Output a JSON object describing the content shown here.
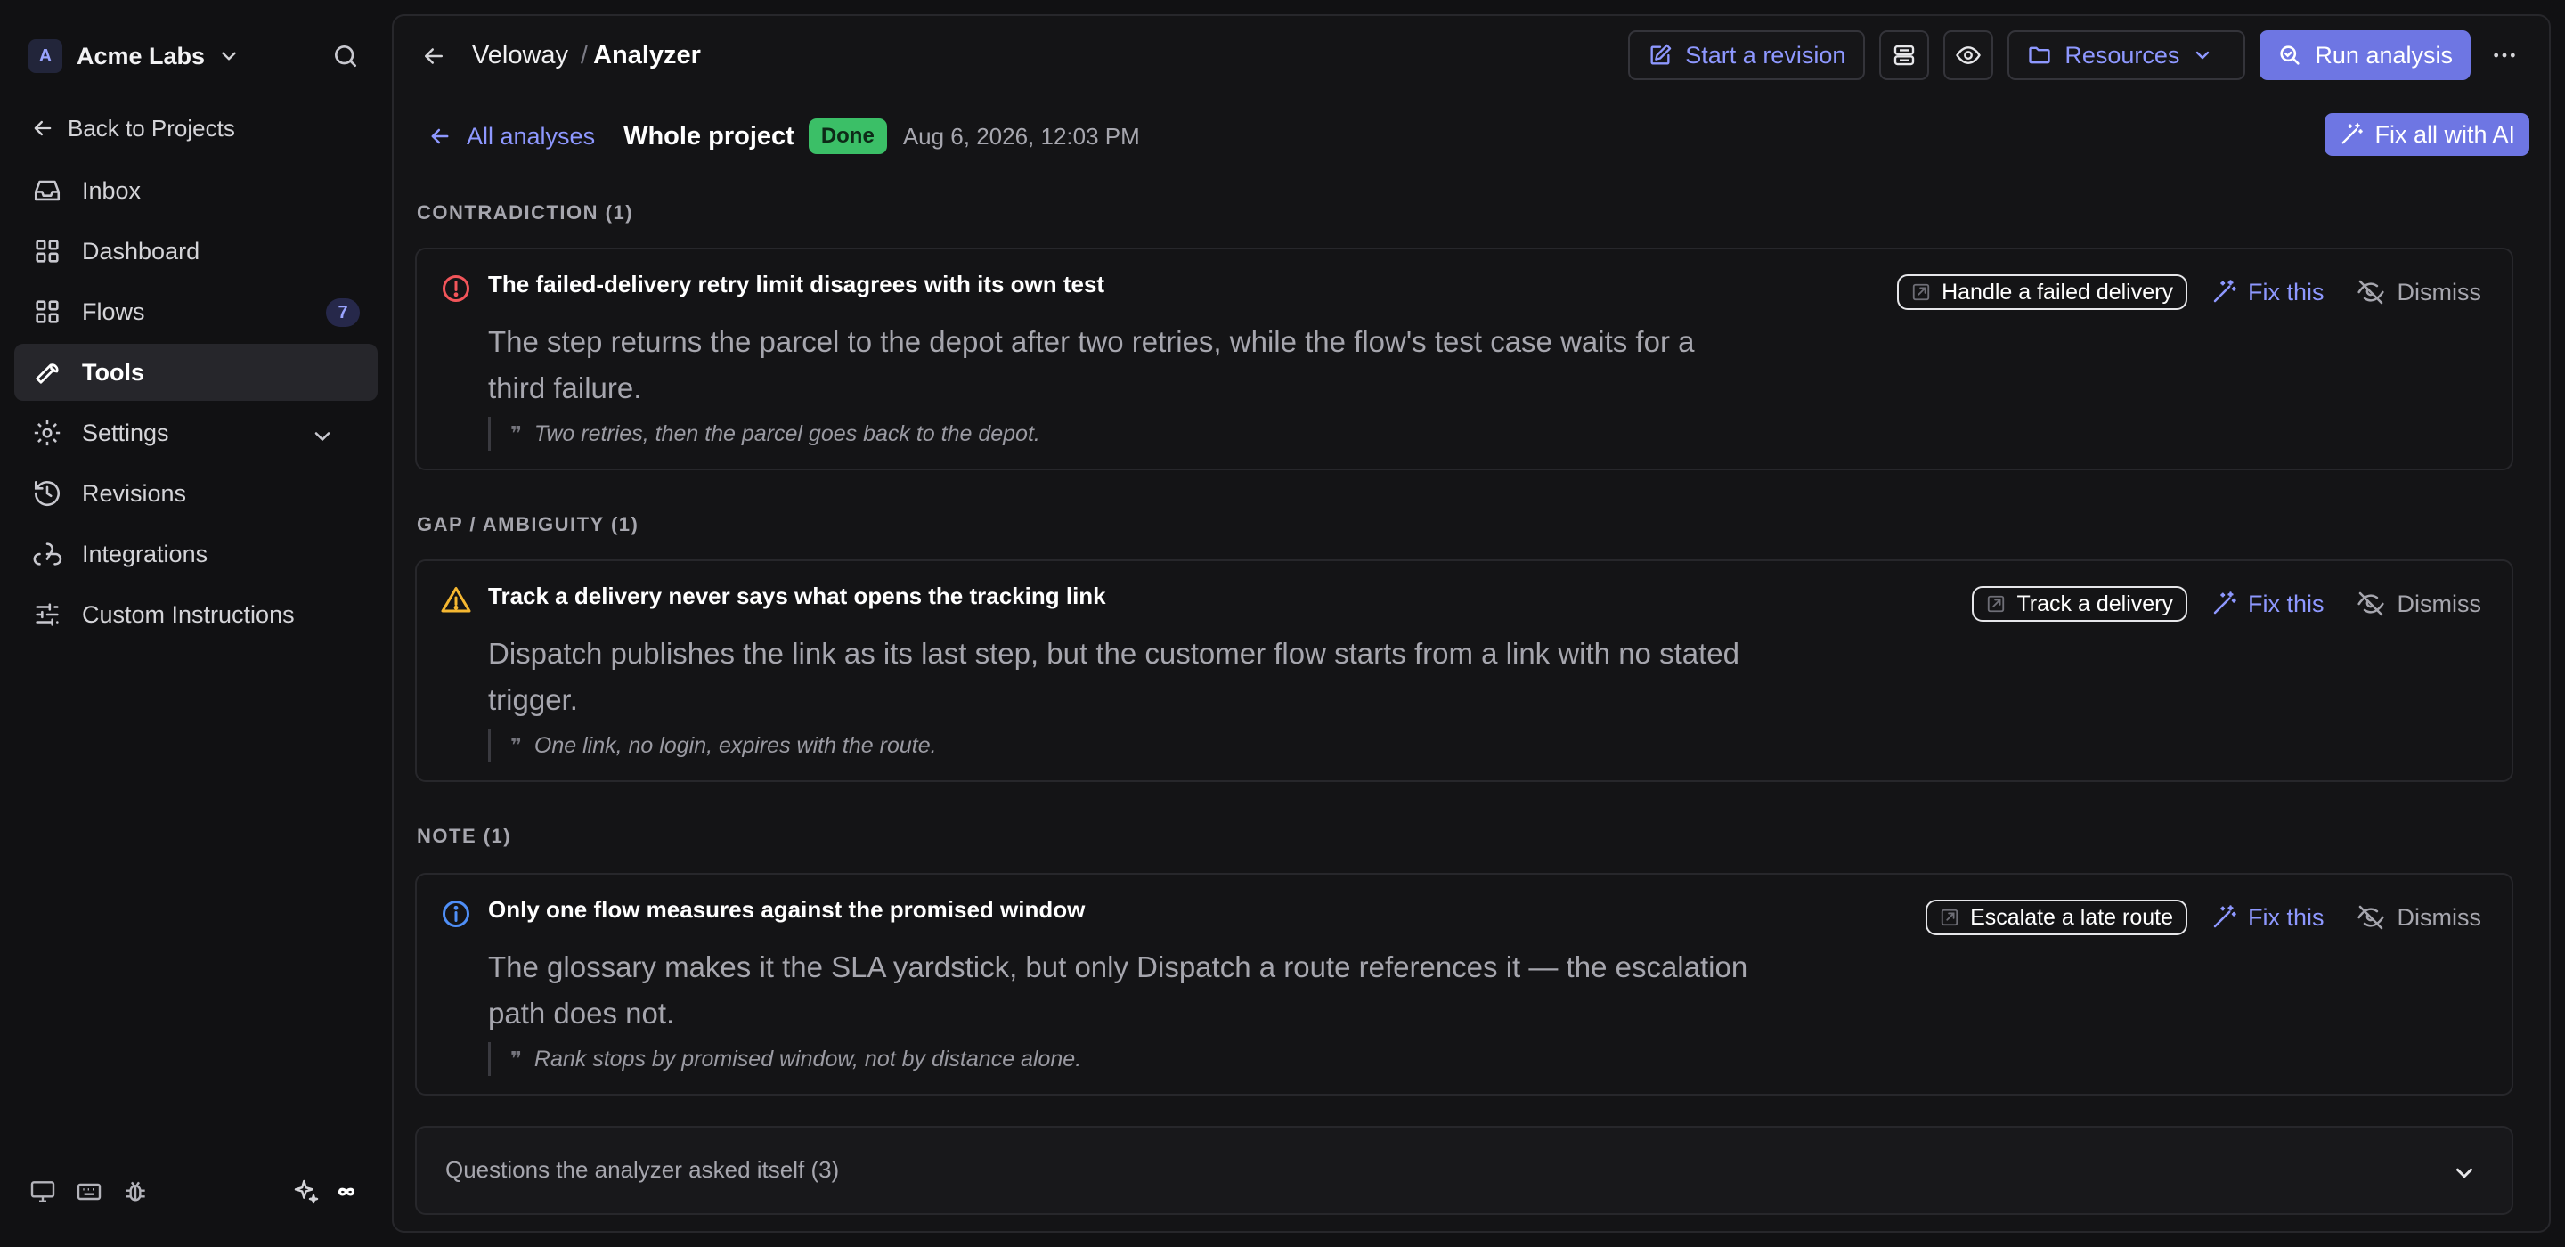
{
  "workspace": {
    "initial": "A",
    "name": "Acme Labs"
  },
  "sidebar": {
    "back_label": "Back to Projects",
    "items": [
      {
        "label": "Inbox",
        "icon": "inbox-icon"
      },
      {
        "label": "Dashboard",
        "icon": "dashboard-icon"
      },
      {
        "label": "Flows",
        "icon": "flows-icon",
        "badge": "7"
      },
      {
        "label": "Tools",
        "icon": "wrench-icon",
        "active": true
      },
      {
        "label": "Settings",
        "icon": "gear-icon"
      },
      {
        "label": "Revisions",
        "icon": "history-icon"
      },
      {
        "label": "Integrations",
        "icon": "webhook-icon"
      },
      {
        "label": "Custom Instructions",
        "icon": "sliders-icon"
      }
    ]
  },
  "header": {
    "project": "Veloway",
    "separator": "/",
    "page": "Analyzer",
    "start_revision": "Start a revision",
    "resources": "Resources",
    "run_analysis": "Run analysis"
  },
  "analysis": {
    "all_analyses": "All analyses",
    "scope": "Whole project",
    "status": "Done",
    "timestamp": "Aug 6, 2026, 12:03 PM",
    "fix_all": "Fix all with AI"
  },
  "sections": [
    {
      "heading": "CONTRADICTION (1)",
      "title": "The failed-delivery retry limit disagrees with its own test",
      "body": "The step returns the parcel to the depot after two retries, while the flow's test case waits for a third failure.",
      "quote": "Two retries, then the parcel goes back to the depot.",
      "flow": "Handle a failed delivery",
      "fix": "Fix this",
      "dismiss": "Dismiss"
    },
    {
      "heading": "GAP / AMBIGUITY (1)",
      "title": "Track a delivery never says what opens the tracking link",
      "body": "Dispatch publishes the link as its last step, but the customer flow starts from a link with no stated trigger.",
      "quote": "One link, no login, expires with the route.",
      "flow": "Track a delivery",
      "fix": "Fix this",
      "dismiss": "Dismiss"
    },
    {
      "heading": "NOTE (1)",
      "title": "Only one flow measures against the promised window",
      "body": "The glossary makes it the SLA yardstick, but only Dispatch a route references it — the escalation path does not.",
      "quote": "Rank stops by promised window, not by distance alone.",
      "flow": "Escalate a late route",
      "fix": "Fix this",
      "dismiss": "Dismiss"
    }
  ],
  "questions": {
    "label": "Questions the analyzer asked itself (3)"
  },
  "colors": {
    "accent": "#6e76e3",
    "accent_text": "#8e98ff",
    "done": "#3bbf67",
    "error": "#f2555a",
    "warning": "#f5b731",
    "info": "#4f8ff7"
  }
}
